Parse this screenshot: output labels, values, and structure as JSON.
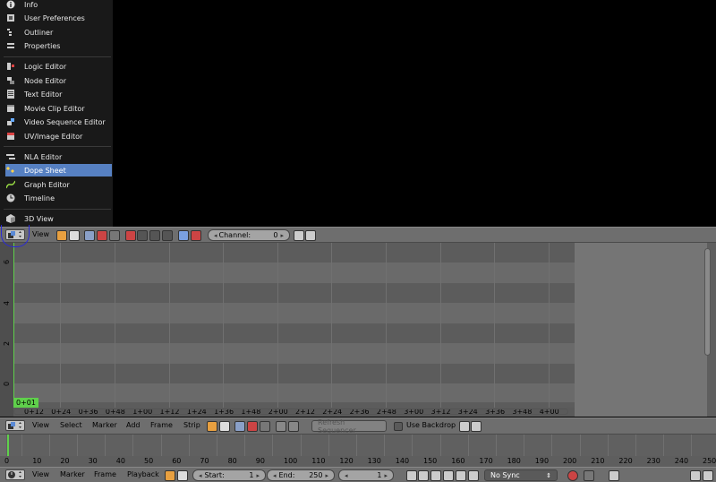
{
  "menu": {
    "items": [
      {
        "label": "Info",
        "icon": "info-icon",
        "top": 0
      },
      {
        "label": "User Preferences",
        "icon": "preferences-icon"
      },
      {
        "label": "Outliner",
        "icon": "outliner-icon"
      },
      {
        "label": "Properties",
        "icon": "properties-icon"
      },
      {
        "label": "Logic Editor",
        "icon": "logic-editor-icon"
      },
      {
        "label": "Node Editor",
        "icon": "node-editor-icon"
      },
      {
        "label": "Text Editor",
        "icon": "text-editor-icon"
      },
      {
        "label": "Movie Clip Editor",
        "icon": "movie-clip-icon"
      },
      {
        "label": "Video Sequence Editor",
        "icon": "video-sequence-icon"
      },
      {
        "label": "UV/Image Editor",
        "icon": "image-editor-icon"
      },
      {
        "label": "NLA Editor",
        "icon": "nla-editor-icon"
      },
      {
        "label": "Dope Sheet",
        "icon": "dope-sheet-icon"
      },
      {
        "label": "Graph Editor",
        "icon": "graph-editor-icon"
      },
      {
        "label": "Timeline",
        "icon": "timeline-icon"
      },
      {
        "label": "3D View",
        "icon": "3d-view-icon"
      }
    ],
    "active": "Dope Sheet"
  },
  "seq_header": {
    "view_label": "View",
    "channel_label": "Channel:",
    "channel_value": "0"
  },
  "seq": {
    "ruler_left": [
      "6",
      "4",
      "2",
      "0"
    ],
    "current_frame": "0+01",
    "time_labels": [
      "0+12",
      "0+24",
      "0+36",
      "0+48",
      "1+00",
      "1+12",
      "1+24",
      "1+36",
      "1+48",
      "2+00",
      "2+12",
      "2+24",
      "2+36",
      "2+48",
      "3+00",
      "3+12",
      "3+24",
      "3+36",
      "3+48",
      "4+00"
    ]
  },
  "seq_footer": {
    "view": "View",
    "select": "Select",
    "marker": "Marker",
    "add": "Add",
    "frame": "Frame",
    "strip": "Strip",
    "refresh": "Refresh Sequencer",
    "use_backdrop": "Use Backdrop"
  },
  "timeline": {
    "labels": [
      "0",
      "10",
      "20",
      "30",
      "40",
      "50",
      "60",
      "70",
      "80",
      "90",
      "100",
      "110",
      "120",
      "130",
      "140",
      "150",
      "160",
      "170",
      "180",
      "190",
      "200",
      "210",
      "220",
      "230",
      "240",
      "250"
    ]
  },
  "tl_header": {
    "view": "View",
    "marker": "Marker",
    "frame": "Frame",
    "playback": "Playback",
    "start_label": "Start:",
    "start_value": "1",
    "end_label": "End:",
    "end_value": "250",
    "current_value": "1",
    "sync": "No Sync"
  }
}
